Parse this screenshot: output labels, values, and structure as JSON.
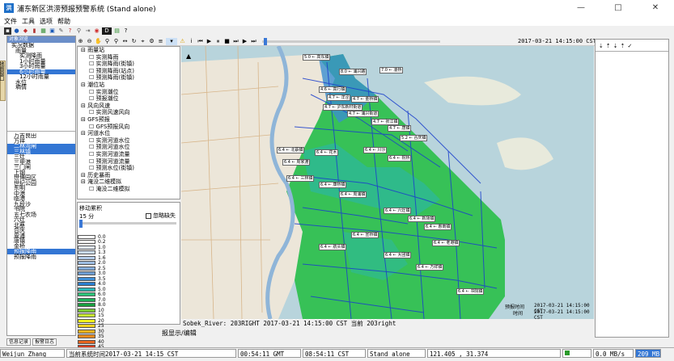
{
  "window": {
    "title": "浦东新区洪涝预报预警系统 (Stand alone)"
  },
  "menu": [
    "文件",
    "工具",
    "选项",
    "帮助"
  ],
  "top_time": "2017-03-21 14:15:00 CST",
  "left_panel": {
    "header": "对象浏览",
    "tree1": [
      {
        "label": "实况数据",
        "selected": false,
        "indent": 1
      },
      {
        "label": "雨量",
        "selected": false,
        "indent": 2
      },
      {
        "label": "实测降雨",
        "selected": false,
        "indent": 3
      },
      {
        "label": "1小时雨量",
        "selected": false,
        "indent": 3
      },
      {
        "label": "3小时雨量",
        "selected": false,
        "indent": 3
      },
      {
        "label": "6小时雨量",
        "selected": true,
        "indent": 3
      },
      {
        "label": "12小时雨量",
        "selected": false,
        "indent": 3
      },
      {
        "label": "水位",
        "selected": false,
        "indent": 2
      },
      {
        "label": "墒情",
        "selected": false,
        "indent": 2
      }
    ],
    "tree2": [
      {
        "label": "万吉良田",
        "selected": false
      },
      {
        "label": "万祥",
        "selected": false
      },
      {
        "label": "二林湾闸",
        "selected": true
      },
      {
        "label": "三林镇",
        "selected": true
      },
      {
        "label": "三灶",
        "selected": false
      },
      {
        "label": "三甲港",
        "selected": false
      },
      {
        "label": "三门闸",
        "selected": false
      },
      {
        "label": "上钢",
        "selected": false
      },
      {
        "label": "世博园区",
        "selected": false
      },
      {
        "label": "世纪公园",
        "selected": false
      },
      {
        "label": "东明",
        "selected": false
      },
      {
        "label": "中港",
        "selected": false
      },
      {
        "label": "临港",
        "selected": false
      },
      {
        "label": "九段沙",
        "selected": false
      },
      {
        "label": "书院",
        "selected": false
      },
      {
        "label": "五七农场",
        "selected": false
      },
      {
        "label": "六灶",
        "selected": false
      },
      {
        "label": "北蔡",
        "selected": false
      },
      {
        "label": "合庆",
        "selected": false
      },
      {
        "label": "周浦",
        "selected": false
      },
      {
        "label": "唐镇",
        "selected": false
      },
      {
        "label": "金桥",
        "selected": false
      }
    ],
    "tree2_footer": [
      {
        "label": "预报降雨",
        "selected": true
      },
      {
        "label": "预报降雨",
        "selected": false
      }
    ]
  },
  "side_tab": "地图窗口",
  "layers": [
    {
      "label": "雨量站",
      "level": 0
    },
    {
      "label": "实测降雨",
      "level": 1
    },
    {
      "label": "实测降雨(街镇)",
      "level": 1
    },
    {
      "label": "预测降雨(站点)",
      "level": 1
    },
    {
      "label": "预测降雨(街镇)",
      "level": 1
    },
    {
      "label": "潮位站",
      "level": 0
    },
    {
      "label": "实测潮位",
      "level": 1
    },
    {
      "label": "预报潮位",
      "level": 1
    },
    {
      "label": "风向风速",
      "level": 0
    },
    {
      "label": "实测风速风向",
      "level": 1
    },
    {
      "label": "GFS预报",
      "level": 0
    },
    {
      "label": "GFS预报风向",
      "level": 1
    },
    {
      "label": "河道水位",
      "level": 0
    },
    {
      "label": "实测河道水位",
      "level": 1
    },
    {
      "label": "预测河道水位",
      "level": 1
    },
    {
      "label": "实测河道流量",
      "level": 1
    },
    {
      "label": "预测河道流量",
      "level": 1
    },
    {
      "label": "预测水位(街镇)",
      "level": 1
    },
    {
      "label": "历史暴雨",
      "level": 0
    },
    {
      "label": "淹没二维模拟",
      "level": 0
    },
    {
      "label": "淹没二维模拟",
      "level": 1
    }
  ],
  "control": {
    "label": "移动累积",
    "checkbox_label": "忽略缺失",
    "interval": "15 分"
  },
  "legend": [
    {
      "label": "0.0",
      "color": "#ffffff"
    },
    {
      "label": "0.2",
      "color": "#f0f0f0"
    },
    {
      "label": "1.0",
      "color": "#dfe8f5"
    },
    {
      "label": "1.3",
      "color": "#c9dbef"
    },
    {
      "label": "1.6",
      "color": "#b3cbe8"
    },
    {
      "label": "2.0",
      "color": "#9dbde2"
    },
    {
      "label": "2.5",
      "color": "#84acd9"
    },
    {
      "label": "3.0",
      "color": "#6f9ed2"
    },
    {
      "label": "3.5",
      "color": "#3f8fd6"
    },
    {
      "label": "4.0",
      "color": "#2a7fd0"
    },
    {
      "label": "5.0",
      "color": "#2ab5b5"
    },
    {
      "label": "6.0",
      "color": "#2ec47a"
    },
    {
      "label": "7.0",
      "color": "#1fb05a"
    },
    {
      "label": "8.0",
      "color": "#18a040"
    },
    {
      "label": "10",
      "color": "#7cc832"
    },
    {
      "label": "15",
      "color": "#c8e632"
    },
    {
      "label": "20",
      "color": "#f0f01e"
    },
    {
      "label": "25",
      "color": "#f5d21e"
    },
    {
      "label": "30",
      "color": "#f0b41e"
    },
    {
      "label": "35",
      "color": "#f08c1e"
    },
    {
      "label": "40",
      "color": "#e6641e"
    },
    {
      "label": "45",
      "color": "#d23c1e"
    },
    {
      "label": "50",
      "color": "#b41e1e"
    }
  ],
  "map": {
    "labels": [
      "5.0 ← 高东镇",
      "8.0 ← 浦兴路",
      "7.0 ← 凌桥",
      "4.6 ← 高行镇",
      "4.7 ← 洋泾",
      "4.7 ← 金桥镇",
      "4.7 ← 沪东新村街道",
      "4.7 ← 浦兴街道",
      "4.7 ← 张江镇",
      "4.7 ← 唐镇",
      "5.2 ← 合庆镇",
      "6.4 ← 北蔡镇",
      "6.4 ← 周家渡",
      "6.4 ← 花木",
      "6.4 ← 川沙",
      "6.4 ← 祝桥",
      "6.4 ← 三林镇",
      "6.4 ← 康桥镇",
      "6.4 ← 周浦镇",
      "6.4 ← 六灶镇",
      "6.4 ← 新场镇",
      "6.4 ← 惠南镇",
      "6.4 ← 宣桥镇",
      "6.4 ← 航头镇",
      "6.4 ← 老港镇",
      "6.4 ← 大团镇",
      "6.4 ← 万祥镇",
      "6.4 ← 书院镇"
    ],
    "time_label_1": "预报时间",
    "time_label_2": "时间",
    "time_value_1": "2017-03-21 14:15:00 CST",
    "time_value_2": "2017-03-21 14:15:00 CST"
  },
  "map_status": "Sobek_River: 203RIGHT 2017-03-21 14:15:00 CST 当前 203right",
  "edit_label": "报显示/编辑",
  "bottom_tabs": [
    "信息记录",
    "报警日志"
  ],
  "status": {
    "user": "Weijun Zhang",
    "sys_time": "当前系统时间2017-03-21 14:15 CST",
    "gmt": "00:54:11 GMT",
    "cst": "08:54:11 CST",
    "mode": "Stand alone",
    "coords": "121.405 , 31.374",
    "speed": "0.0 MB/s",
    "mem": "209 MB"
  }
}
